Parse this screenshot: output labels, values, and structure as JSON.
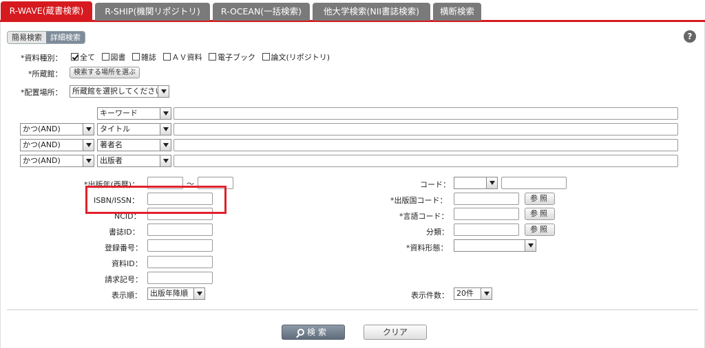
{
  "tabs": [
    {
      "label": "R-WAVE(蔵書検索)",
      "active": true
    },
    {
      "label": "R-SHIP(機関リポジトリ)",
      "active": false
    },
    {
      "label": "R-OCEAN(一括検索)",
      "active": false
    },
    {
      "label": "他大学検索(NII書誌検索)",
      "active": false
    },
    {
      "label": "横断検索",
      "active": false
    }
  ],
  "mode": {
    "simple": "簡易検索",
    "detailed": "詳細検索"
  },
  "help_icon": "?",
  "material_type": {
    "label": "*資料種別：",
    "options": [
      {
        "label": "全て",
        "checked": true
      },
      {
        "label": "図書",
        "checked": false
      },
      {
        "label": "雑誌",
        "checked": false
      },
      {
        "label": "ＡＶ資料",
        "checked": false
      },
      {
        "label": "電子ブック",
        "checked": false
      },
      {
        "label": "論文(リポジトリ)",
        "checked": false
      }
    ]
  },
  "holding_library": {
    "label": "*所蔵館：",
    "button": "検索する場所を選ぶ"
  },
  "location": {
    "label": "*配置場所：",
    "value": "所蔵館を選択してください"
  },
  "keyword_rows": [
    {
      "operator": "",
      "field": "キーワード",
      "value": ""
    },
    {
      "operator": "かつ(AND)",
      "field": "タイトル",
      "value": ""
    },
    {
      "operator": "かつ(AND)",
      "field": "著者名",
      "value": ""
    },
    {
      "operator": "かつ(AND)",
      "field": "出版者",
      "value": ""
    }
  ],
  "left_fields": {
    "pub_year": {
      "label": "*出版年(西暦)：",
      "sep": "～"
    },
    "isbn": {
      "label": "ISBN/ISSN："
    },
    "ncid": {
      "label": "NCID："
    },
    "bib_id": {
      "label": "書誌ID："
    },
    "reg_no": {
      "label": "登録番号："
    },
    "item_id": {
      "label": "資料ID："
    },
    "call_no": {
      "label": "請求記号："
    },
    "sort": {
      "label": "表示順：",
      "value": "出版年降順"
    }
  },
  "right_fields": {
    "code": {
      "label": "コード："
    },
    "pub_country": {
      "label": "*出版国コード：",
      "button": "参照"
    },
    "lang": {
      "label": "*言語コード：",
      "button": "参照"
    },
    "classification": {
      "label": "分類：",
      "button": "参照"
    },
    "format": {
      "label": "*資料形態："
    },
    "count": {
      "label": "表示件数：",
      "value": "20件"
    }
  },
  "actions": {
    "search": "検索",
    "clear": "クリア"
  },
  "colors": {
    "accent": "#d61a1f",
    "tab_inactive": "#7a7a7a",
    "highlight": "#e0202a"
  }
}
